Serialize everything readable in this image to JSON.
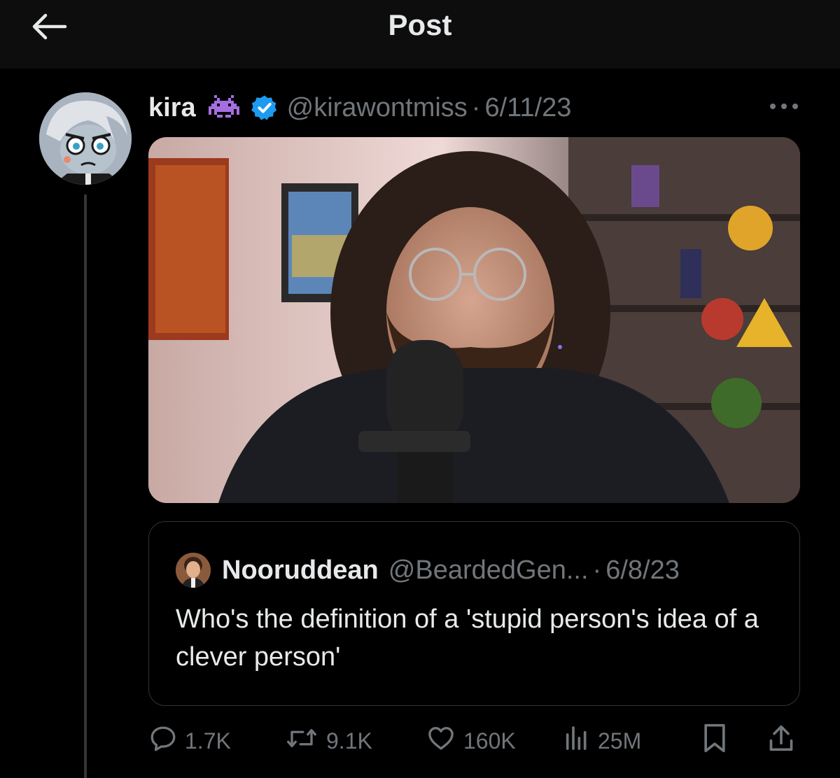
{
  "header": {
    "title": "Post"
  },
  "post": {
    "author_name": "kira",
    "handle": "@kirawontmiss",
    "separator": "·",
    "date": "6/11/23",
    "badges": [
      "alien-monster-emoji",
      "verified-badge"
    ]
  },
  "quote": {
    "author_name": "Nooruddean",
    "handle": "@BeardedGen...",
    "separator": "·",
    "date": "6/8/23",
    "text": "Who's the definition of a 'stupid person's idea of a clever person'"
  },
  "actions": {
    "replies": "1.7K",
    "reposts": "9.1K",
    "likes": "160K",
    "views": "25M"
  },
  "colors": {
    "background": "#000000",
    "topbar": "#0d0d0d",
    "text_primary": "#e7e9ea",
    "text_secondary": "#71767b",
    "verified": "#1d9bf0",
    "border": "#2f3336"
  }
}
